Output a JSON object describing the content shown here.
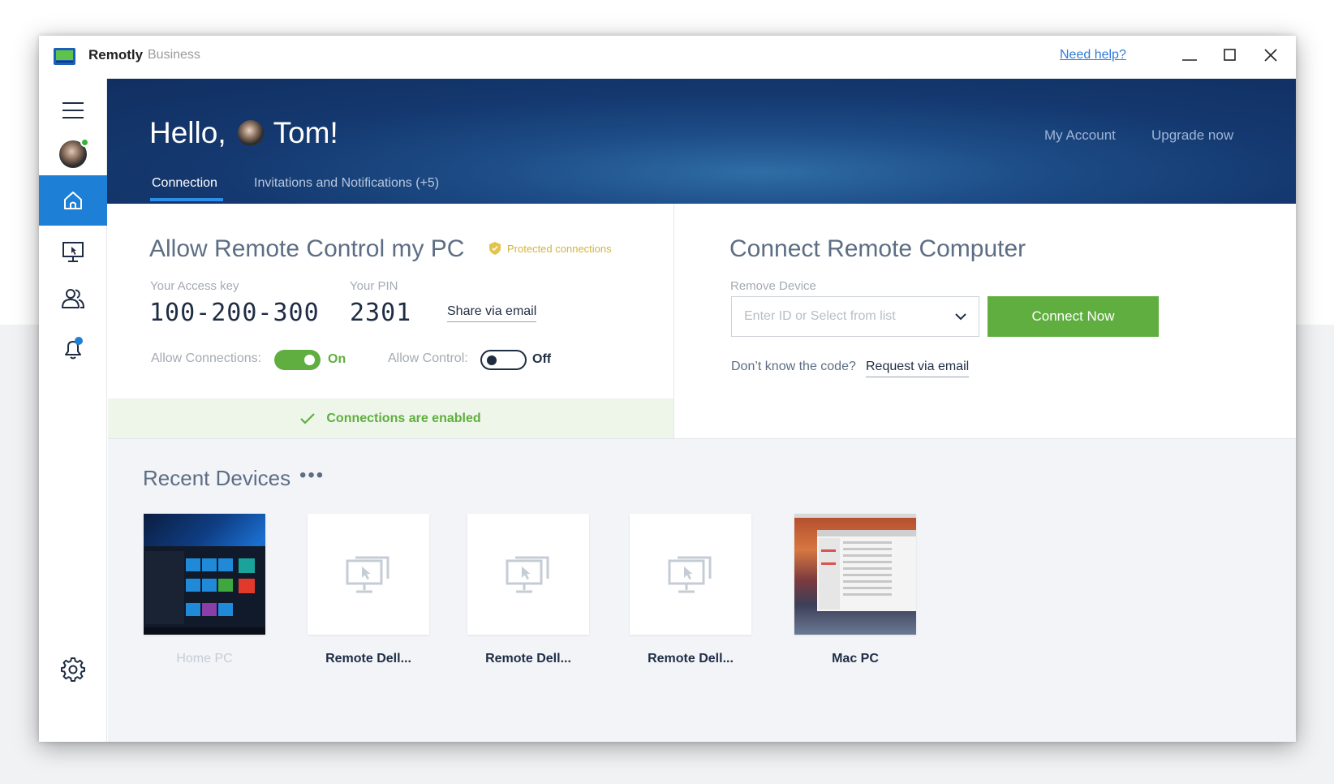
{
  "window": {
    "app_name": "Remotly",
    "app_edition": "Business",
    "need_help": "Need help?"
  },
  "header": {
    "greeting_prefix": "Hello,",
    "user_name": "Tom!",
    "my_account": "My Account",
    "upgrade_now": "Upgrade now",
    "tabs": [
      {
        "label": "Connection",
        "active": true
      },
      {
        "label": "Invitations and Notifications (+5)",
        "active": false
      }
    ]
  },
  "sidebar": {
    "items": [
      {
        "icon": "menu-icon"
      },
      {
        "icon": "avatar"
      },
      {
        "icon": "home-icon",
        "active": true
      },
      {
        "icon": "remote-desktop-icon"
      },
      {
        "icon": "contacts-icon"
      },
      {
        "icon": "bell-icon"
      },
      {
        "icon": "gear-icon"
      }
    ]
  },
  "allow_panel": {
    "title": "Allow Remote Control my PC",
    "protected_label": "Protected connections",
    "access_key_label": "Your Access key",
    "access_key_value": "100-200-300",
    "pin_label": "Your PIN",
    "pin_value": "2301",
    "share_via_email": "Share via email",
    "allow_connections_label": "Allow Connections:",
    "allow_connections_state": "On",
    "allow_control_label": "Allow Control:",
    "allow_control_state": "Off",
    "status_text": "Connections are enabled"
  },
  "connect_panel": {
    "title": "Connect Remote Computer",
    "device_label": "Remove Device",
    "device_placeholder": "Enter ID or Select from list",
    "connect_button": "Connect Now",
    "dont_know": "Don’t know the code?",
    "request_via_email": "Request via email"
  },
  "recent_devices": {
    "title": "Recent Devices",
    "more": "•••",
    "devices": [
      {
        "name": "Home PC",
        "thumb": "windows-screenshot",
        "dim": true
      },
      {
        "name": "Remote Dell...",
        "thumb": "remote-desktop-icon"
      },
      {
        "name": "Remote Dell...",
        "thumb": "remote-desktop-icon"
      },
      {
        "name": "Remote Dell...",
        "thumb": "remote-desktop-icon"
      },
      {
        "name": "Mac PC",
        "thumb": "mac-screenshot"
      }
    ]
  },
  "colors": {
    "accent_blue": "#1d7fd6",
    "header_navy": "#14386f",
    "success_green": "#5fae3f",
    "protected_gold": "#d3b43f"
  }
}
